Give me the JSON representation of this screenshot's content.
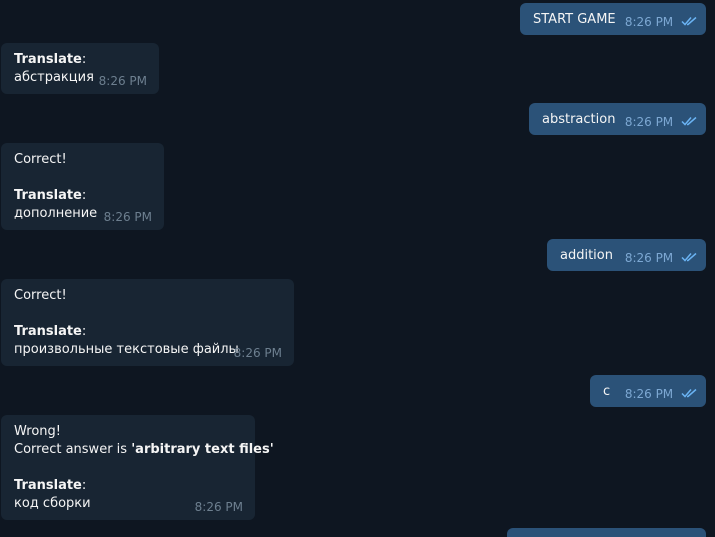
{
  "messages": [
    {
      "id": "m1",
      "dir": "out",
      "text": "START GAME",
      "time": "8:26 PM"
    },
    {
      "id": "m2",
      "dir": "in",
      "translate_label": "Translate",
      "word": "абстракция",
      "time": "8:26 PM"
    },
    {
      "id": "m3",
      "dir": "out",
      "text": "abstraction",
      "time": "8:26 PM"
    },
    {
      "id": "m4",
      "dir": "in",
      "status": "Correct!",
      "translate_label": "Translate",
      "word": "дополнение",
      "time": "8:26 PM"
    },
    {
      "id": "m5",
      "dir": "out",
      "text": "addition",
      "time": "8:26 PM"
    },
    {
      "id": "m6",
      "dir": "in",
      "status": "Correct!",
      "translate_label": "Translate",
      "word": "произвольные текстовые файлы",
      "time": "8:26 PM"
    },
    {
      "id": "m7",
      "dir": "out",
      "text": "c",
      "time": "8:26 PM"
    },
    {
      "id": "m8",
      "dir": "in",
      "status": "Wrong!",
      "correct_prefix": "Correct answer is ",
      "correct_answer": "'arbitrary text files'",
      "translate_label": "Translate",
      "word": "код сборки",
      "time": "8:26 PM"
    }
  ],
  "colors": {
    "background": "#0e1621",
    "incoming_bubble": "#182533",
    "outgoing_bubble": "#2b5278",
    "read_ticks": "#6ab3f3"
  },
  "icons": {
    "read_status": "double-check-icon"
  }
}
